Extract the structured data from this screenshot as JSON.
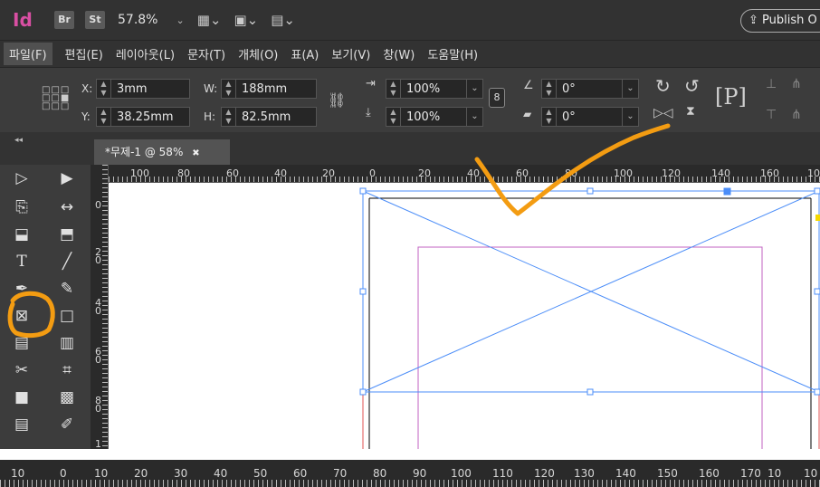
{
  "app": {
    "logo": "Id",
    "bridge": "Br",
    "stock": "St",
    "zoom": "57.8%",
    "publish_label": "Publish O"
  },
  "menu": [
    "파일(F)",
    "편집(E)",
    "레이아웃(L)",
    "문자(T)",
    "개체(O)",
    "표(A)",
    "보기(V)",
    "창(W)",
    "도움말(H)"
  ],
  "control": {
    "x_label": "X:",
    "x_value": "3mm",
    "y_label": "Y:",
    "y_value": "38.25mm",
    "w_label": "W:",
    "w_value": "188mm",
    "h_label": "H:",
    "h_value": "82.5mm",
    "scale_x": "100%",
    "scale_y": "100%",
    "rotate": "0°",
    "shear": "0°"
  },
  "tab": {
    "title": "*무제-1 @ 58%",
    "close": "✖"
  },
  "rulers": {
    "top": [
      "100",
      "80",
      "60",
      "40",
      "20",
      "0",
      "20",
      "40",
      "60",
      "80",
      "100",
      "120",
      "140",
      "160",
      "10"
    ],
    "left": [
      "0",
      "2\n0",
      "4\n0",
      "6\n0",
      "8\n0",
      "1"
    ],
    "bottom": [
      "10",
      "0",
      "10",
      "20",
      "30",
      "40",
      "50",
      "60",
      "70",
      "80",
      "90",
      "100",
      "110",
      "120",
      "130",
      "140",
      "150",
      "160",
      "170",
      "10",
      "10"
    ]
  },
  "colors": {
    "highlight": "#f39c12",
    "frame": "#4b8df8",
    "margin": "#c060c0"
  }
}
